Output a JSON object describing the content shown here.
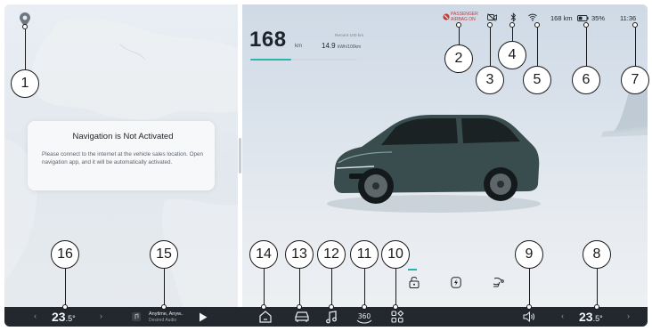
{
  "navigation": {
    "title": "Navigation is Not Activated",
    "message": "Please connect to the internet at the vehicle sales location. Open navigation app, and it will be automatically activated."
  },
  "vehicle": {
    "range_value": "168",
    "range_unit": "km",
    "record_label": "Recent 100 km",
    "record_value": "14.9",
    "record_unit": "kWh/100km",
    "range_fill_fraction": 0.38
  },
  "status": {
    "airbag_line1": "PASSENGER",
    "airbag_line2": "AIRBAG ON",
    "range": "168 km",
    "battery": "35%",
    "time": "11:36"
  },
  "dock": {
    "temp_left": "23",
    "temp_left_decimal": ".5°",
    "temp_right": "23",
    "temp_right_decimal": ".5°",
    "chevron_left": "‹",
    "chevron_right": "›",
    "media_title": "Anytime, Anyw..",
    "media_source": "Desired Audio",
    "icon_360_label": "360"
  },
  "callouts": [
    "1",
    "2",
    "3",
    "4",
    "5",
    "6",
    "7",
    "8",
    "9",
    "10",
    "11",
    "12",
    "13",
    "14",
    "15",
    "16"
  ],
  "colors": {
    "accent": "#2bb5a9",
    "dock": "#23282e",
    "warning": "#c23b3b"
  }
}
